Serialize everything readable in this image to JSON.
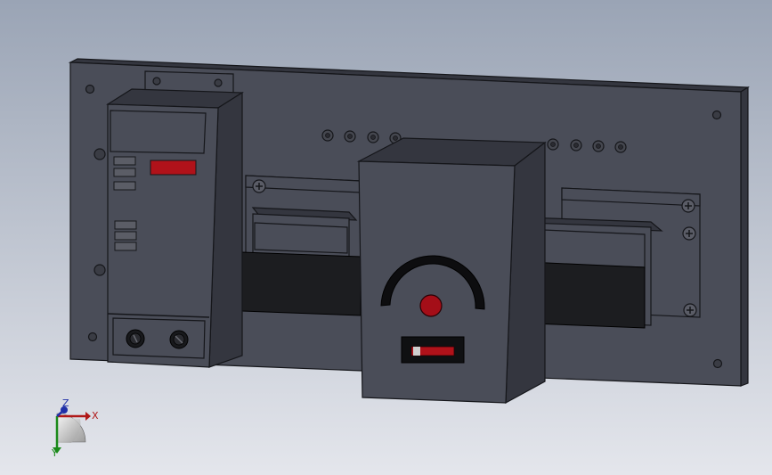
{
  "scene": {
    "background_top": "#9aa4b5",
    "background_bottom": "#e4e6ec",
    "panel_face": "#4a4d58",
    "panel_edge": "#34363f",
    "module_face": "#45474f",
    "outline": "#15161a",
    "strap": "#1c1d20"
  },
  "indicators": {
    "display_color": "#b0121a",
    "lamp_color": "#a40e18",
    "slot_color": "#b0121a"
  },
  "triad": {
    "x_label": "X",
    "y_label": "Y",
    "z_label": "Z",
    "x_color": "#b01818",
    "y_color": "#1a8a1a",
    "z_color": "#2030a8"
  }
}
